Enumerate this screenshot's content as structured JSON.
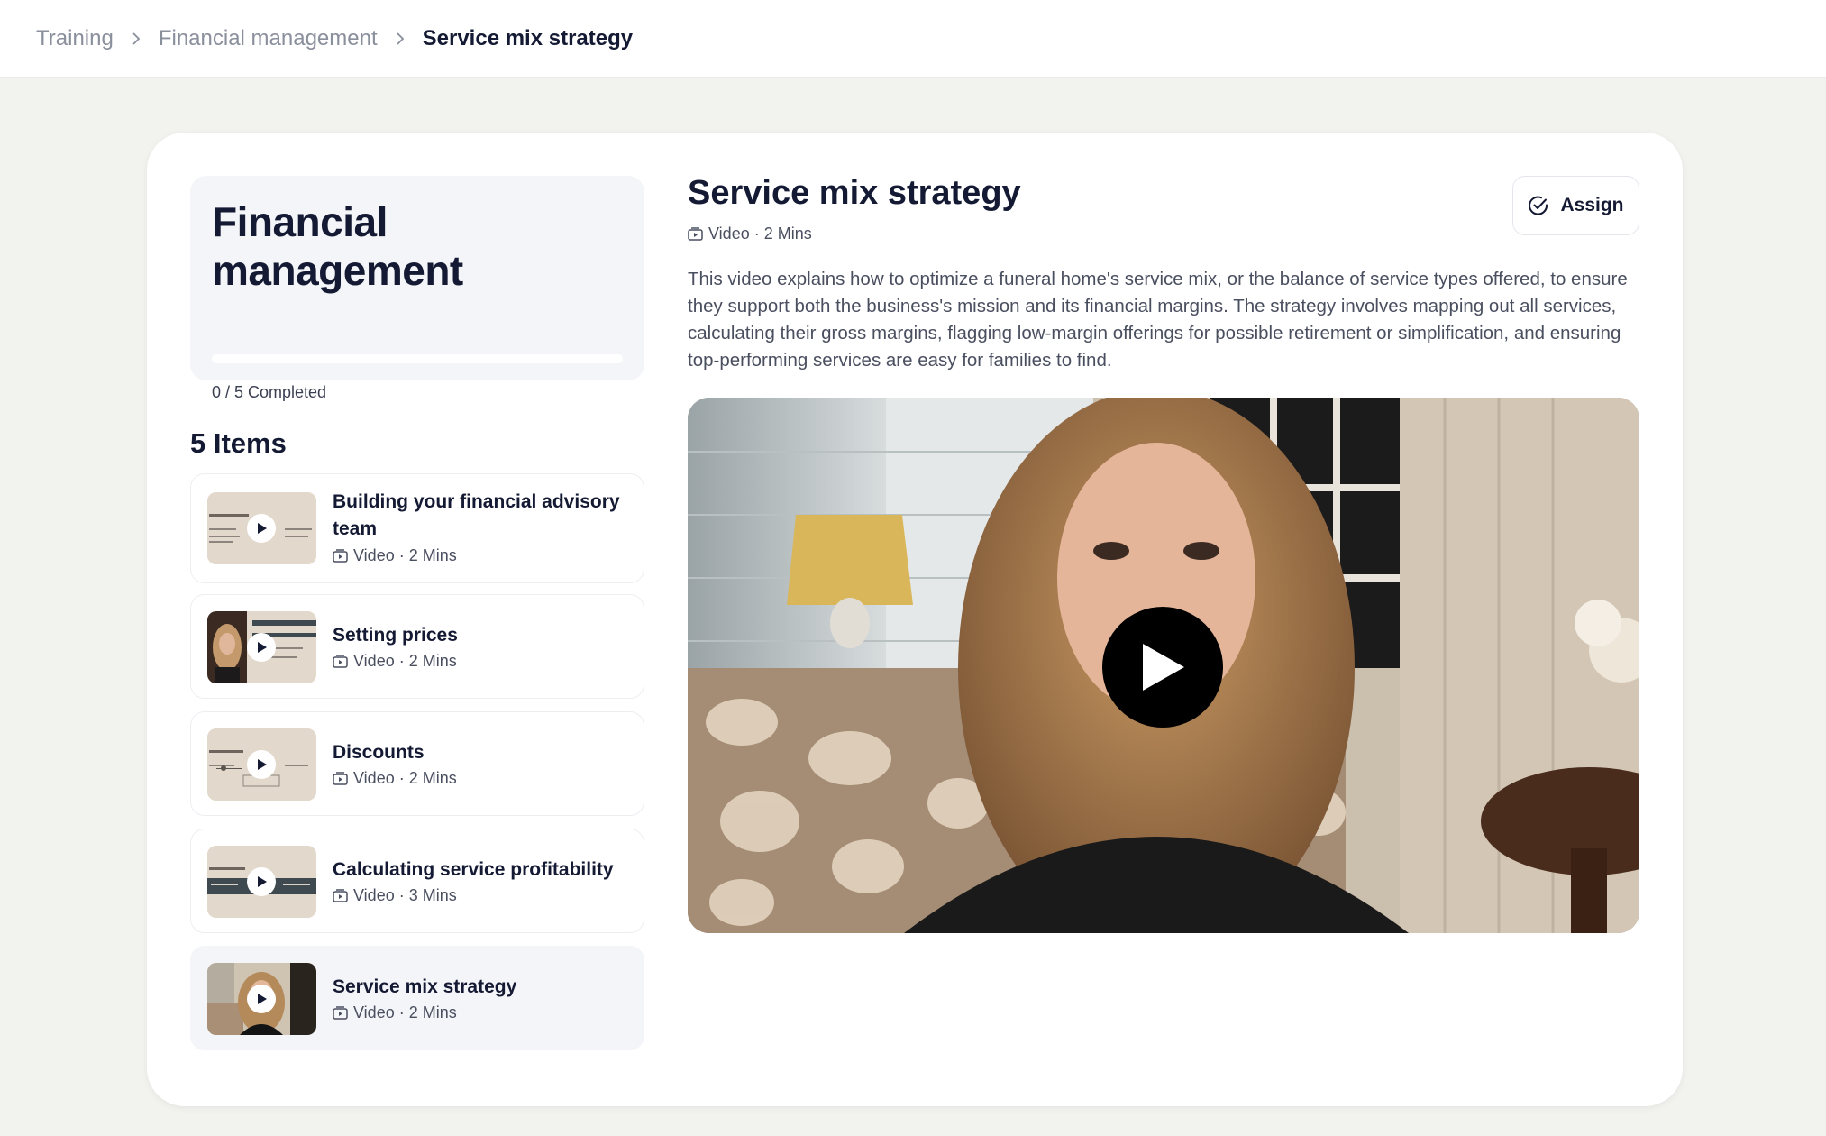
{
  "breadcrumb": {
    "items": [
      "Training",
      "Financial management",
      "Service mix strategy"
    ]
  },
  "course": {
    "title": "Financial management",
    "progress_text": "0 / 5 Completed",
    "progress_fraction": 0,
    "items_heading": "5 Items"
  },
  "items": [
    {
      "title": "Building your financial advisory team",
      "meta": "Video · 2 Mins",
      "thumb": "slide-thumbnail"
    },
    {
      "title": "Setting prices",
      "meta": "Video · 2 Mins",
      "thumb": "presenter-slide-thumbnail"
    },
    {
      "title": "Discounts",
      "meta": "Video · 2 Mins",
      "thumb": "slide-thumbnail"
    },
    {
      "title": "Calculating service profitability",
      "meta": "Video · 3 Mins",
      "thumb": "slide-thumbnail"
    },
    {
      "title": "Service mix strategy",
      "meta": "Video · 2 Mins",
      "thumb": "presenter-thumbnail",
      "active": true
    }
  ],
  "lesson": {
    "title": "Service mix strategy",
    "meta": "Video · 2 Mins",
    "assign_label": "Assign",
    "description": "This video explains how to optimize a funeral home's service mix, or the balance of service types offered, to ensure they support both the business's mission and its financial margins. The strategy involves mapping out all services, calculating their gross margins, flagging low-margin offerings for possible retirement or simplification, and ensuring top-performing services are easy for families to find."
  },
  "icons": {
    "breadcrumb_separator": "chevron-right-icon",
    "video_type": "video-icon",
    "assign": "check-circle-icon",
    "play": "play-icon"
  },
  "colors": {
    "text_primary": "#141a33",
    "text_muted": "#8a8f9c",
    "background": "#f2f2ee",
    "card": "#ffffff",
    "panel": "#f4f5f8"
  }
}
